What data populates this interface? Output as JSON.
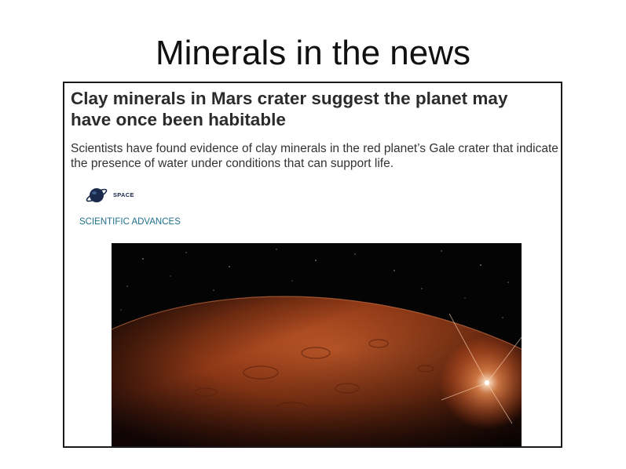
{
  "slide": {
    "title": "Minerals in the news"
  },
  "article": {
    "headline": "Clay minerals in Mars crater suggest the planet may have once been habitable",
    "standfirst": "Scientists have found evidence of clay minerals in the red planet’s Gale crater that indicate the presence of water under conditions that can support life.",
    "logo_label": "SPACE",
    "section_link": "SCIENTIFIC ADVANCES",
    "image_icon": "mars-planet-image",
    "colors": {
      "link": "#1f6f8b",
      "planet": "#a9461f",
      "space": "#050404"
    }
  }
}
